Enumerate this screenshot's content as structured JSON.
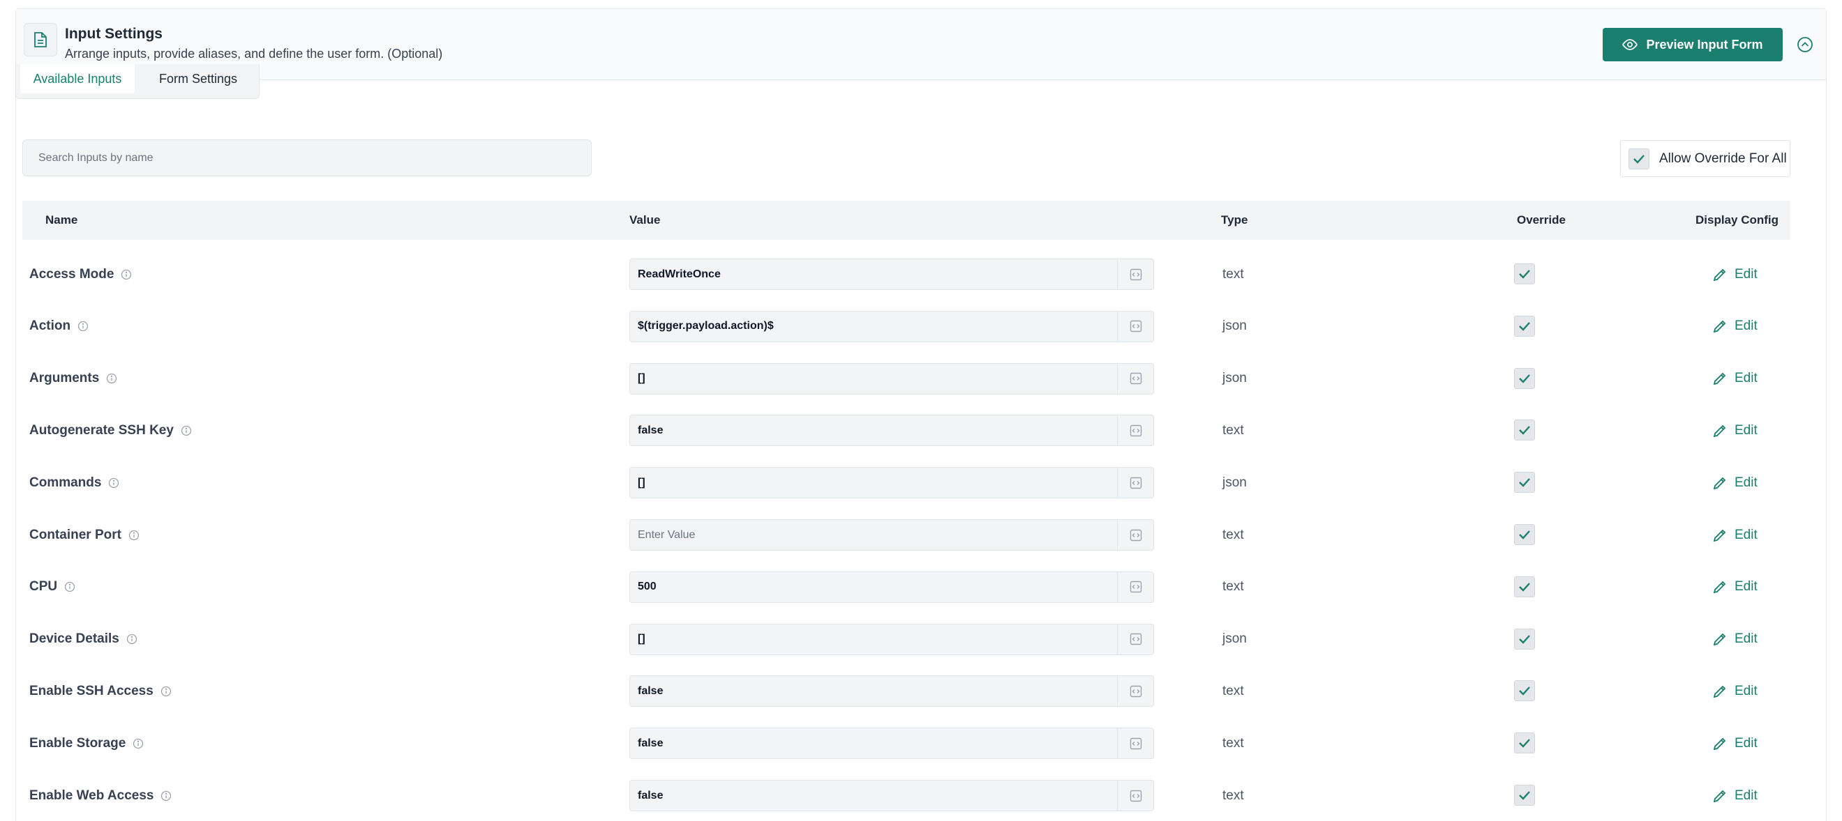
{
  "header": {
    "title": "Input Settings",
    "subtitle": "Arrange inputs, provide aliases, and define the user form. (Optional)",
    "preview_button": "Preview Input Form"
  },
  "tabs": [
    {
      "label": "Available Inputs",
      "active": true
    },
    {
      "label": "Form Settings",
      "active": false
    }
  ],
  "search": {
    "placeholder": "Search Inputs by name"
  },
  "allow_override_all": {
    "label": "Allow Override For All",
    "checked": true
  },
  "table": {
    "columns": {
      "name": "Name",
      "value": "Value",
      "type": "Type",
      "override": "Override",
      "display": "Display Config"
    },
    "value_placeholder": "Enter Value",
    "edit_label": "Edit",
    "rows": [
      {
        "name": "Access Mode",
        "value": "ReadWriteOnce",
        "type": "text",
        "override": true
      },
      {
        "name": "Action",
        "value": "$(trigger.payload.action)$",
        "type": "json",
        "override": true
      },
      {
        "name": "Arguments",
        "value": "[]",
        "type": "json",
        "override": true
      },
      {
        "name": "Autogenerate SSH Key",
        "value": "false",
        "type": "text",
        "override": true
      },
      {
        "name": "Commands",
        "value": "[]",
        "type": "json",
        "override": true
      },
      {
        "name": "Container Port",
        "value": "",
        "type": "text",
        "override": true
      },
      {
        "name": "CPU",
        "value": "500",
        "type": "text",
        "override": true
      },
      {
        "name": "Device Details",
        "value": "[]",
        "type": "json",
        "override": true
      },
      {
        "name": "Enable SSH Access",
        "value": "false",
        "type": "text",
        "override": true
      },
      {
        "name": "Enable Storage",
        "value": "false",
        "type": "text",
        "override": true
      },
      {
        "name": "Enable Web Access",
        "value": "false",
        "type": "text",
        "override": true
      }
    ]
  },
  "colors": {
    "accent": "#1a7f6e",
    "header_bg": "#f9fafb",
    "field_bg": "#f3f4f6"
  },
  "icons": {
    "header": "document-icon",
    "preview": "eye-icon",
    "collapse": "chevron-up-circle-icon",
    "info": "info-icon",
    "code": "code-icon",
    "check": "check-icon",
    "edit": "pencil-icon"
  }
}
